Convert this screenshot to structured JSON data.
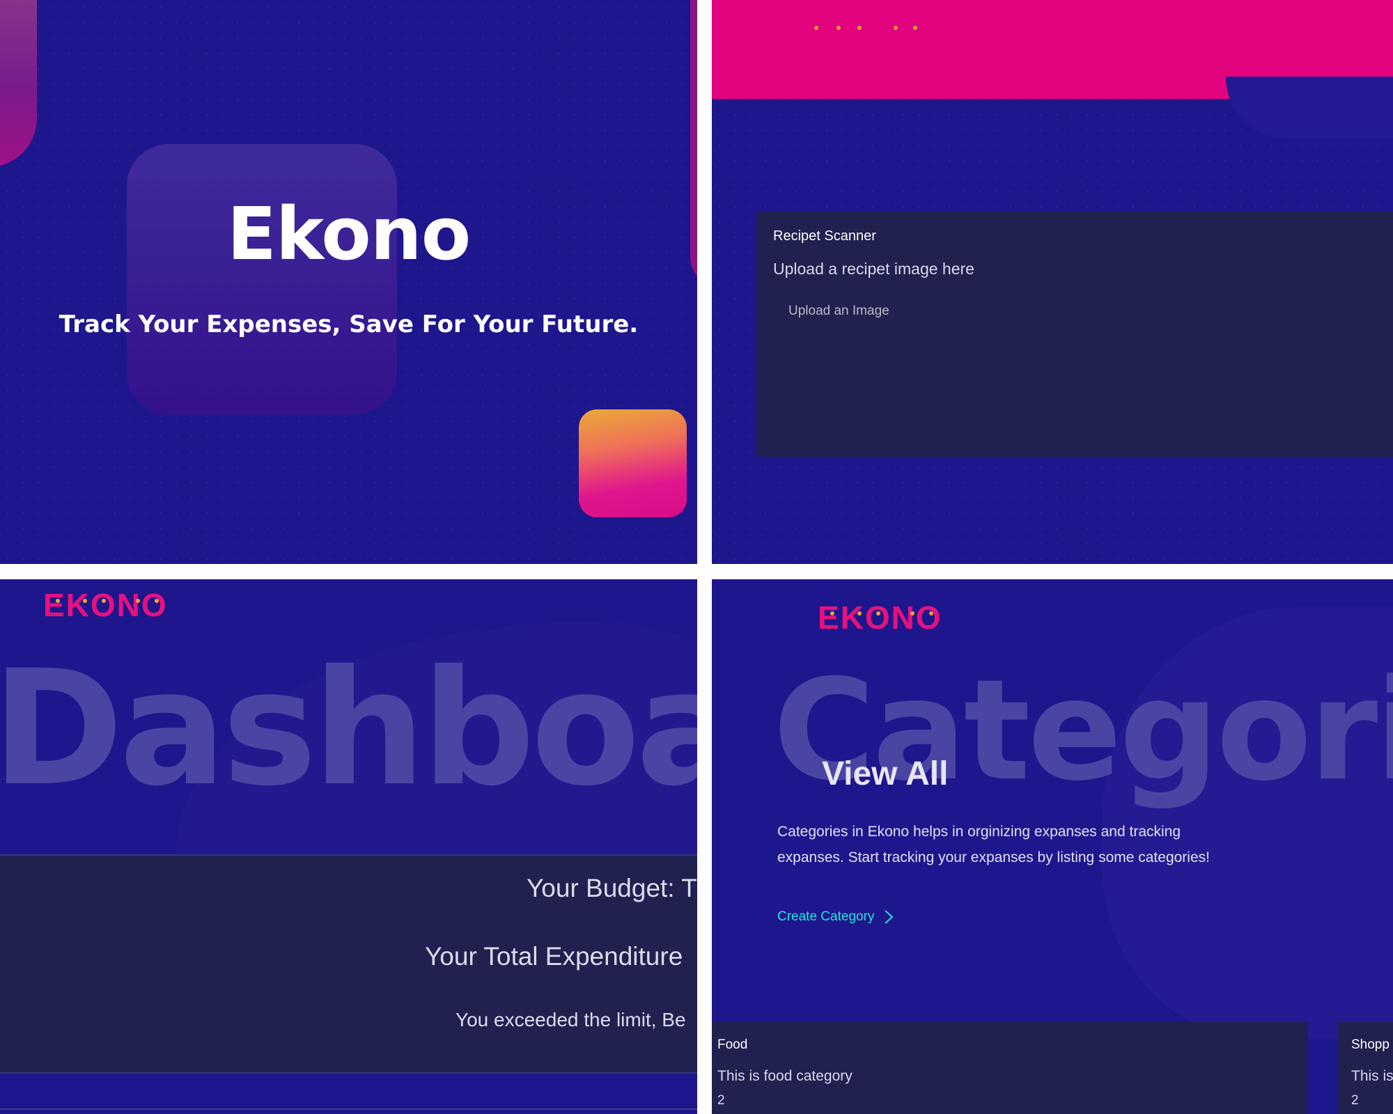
{
  "hero": {
    "title": "Ekono",
    "tagline": "Track Your Expenses, Save For Your Future."
  },
  "scanner": {
    "title": "Recipet Scanner",
    "subtitle": "Upload a recipet image here",
    "upload_button": "Upload an Image"
  },
  "dashboard": {
    "logo": "EKONO",
    "background_word": "Dashboard",
    "budget_label": "Your Budget: T",
    "expenditure_label": "Your Total Expenditure",
    "warning": "You exceeded the limit, Be"
  },
  "categories": {
    "logo": "EKONO",
    "background_word": "Categories",
    "heading": "View All",
    "description": "Categories in Ekono helps in orginizing expanses and tracking expanses. Start tracking your expanses by listing some categories!",
    "create_link": "Create Category",
    "items": [
      {
        "title": "Food",
        "description": "This is food category",
        "count": "2"
      },
      {
        "title": "Shopp",
        "description": "This is",
        "count": "2"
      }
    ]
  },
  "colors": {
    "background": "#1e168c",
    "card": "#20214f",
    "accent_pink": "#e3037e",
    "accent_teal": "#21e6dd",
    "logo_dots": "#f0a03a"
  }
}
